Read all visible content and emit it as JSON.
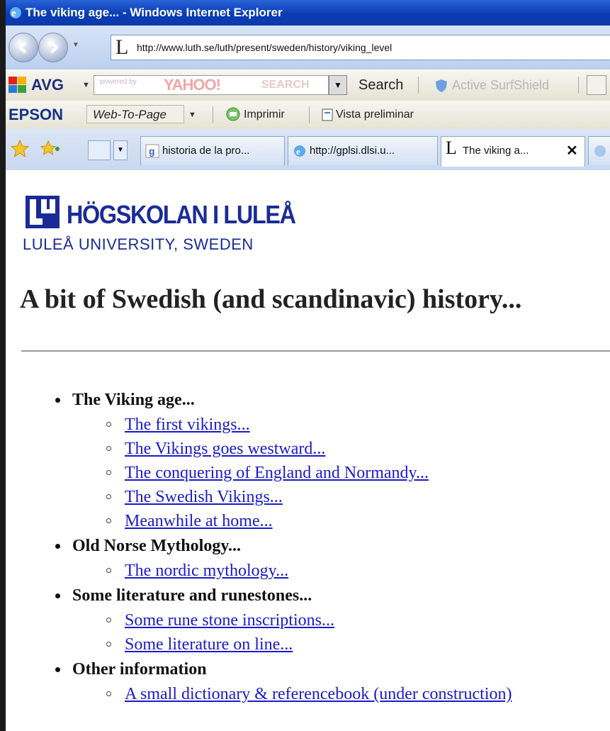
{
  "window": {
    "title": "The viking age... - Windows Internet Explorer"
  },
  "address_bar": {
    "url": "http://www.luth.se/luth/present/sweden/history/viking_level",
    "favicon_letter": "L"
  },
  "avg_toolbar": {
    "label": "AVG",
    "search_powered_by": "powered by",
    "search_brand": "YAHOO!",
    "search_brand_suffix": "SEARCH",
    "search_button": "Search",
    "surfshield": "Active SurfShield"
  },
  "epson_toolbar": {
    "label": "EPSON",
    "web_to_page": "Web-To-Page",
    "print": "Imprimir",
    "preview": "Vista preliminar"
  },
  "tabs": [
    {
      "label": "historia de la pro...",
      "icon": "google-icon"
    },
    {
      "label": "http://gplsi.dlsi.u...",
      "icon": "ie-page-icon"
    },
    {
      "label": "The viking a...",
      "icon": "luleå-favicon",
      "active": true,
      "close": "✕"
    },
    {
      "label": "",
      "icon": "ie-page-icon"
    }
  ],
  "page": {
    "logo_name": "HÖGSKOLAN I LULEÅ",
    "logo_sub": "LULEÅ UNIVERSITY, SWEDEN",
    "heading": "A bit of Swedish (and scandinavic) history...",
    "sections": [
      {
        "title": "The Viking age...",
        "links": [
          "The first vikings...",
          "The Vikings goes westward...",
          "The conquering of England and Normandy...",
          "The Swedish Vikings...",
          "Meanwhile at home..."
        ]
      },
      {
        "title": "Old Norse Mythology...",
        "links": [
          "The nordic mythology..."
        ]
      },
      {
        "title": "Some literature and runestones...",
        "links": [
          "Some rune stone inscriptions...",
          "Some literature on line..."
        ]
      },
      {
        "title": "Other information",
        "links": [
          "A small dictionary & referencebook (under construction)"
        ]
      }
    ]
  },
  "colors": {
    "link": "#1a1acc",
    "logo": "#1b2b96",
    "titlebar": "#0a3cb5"
  }
}
